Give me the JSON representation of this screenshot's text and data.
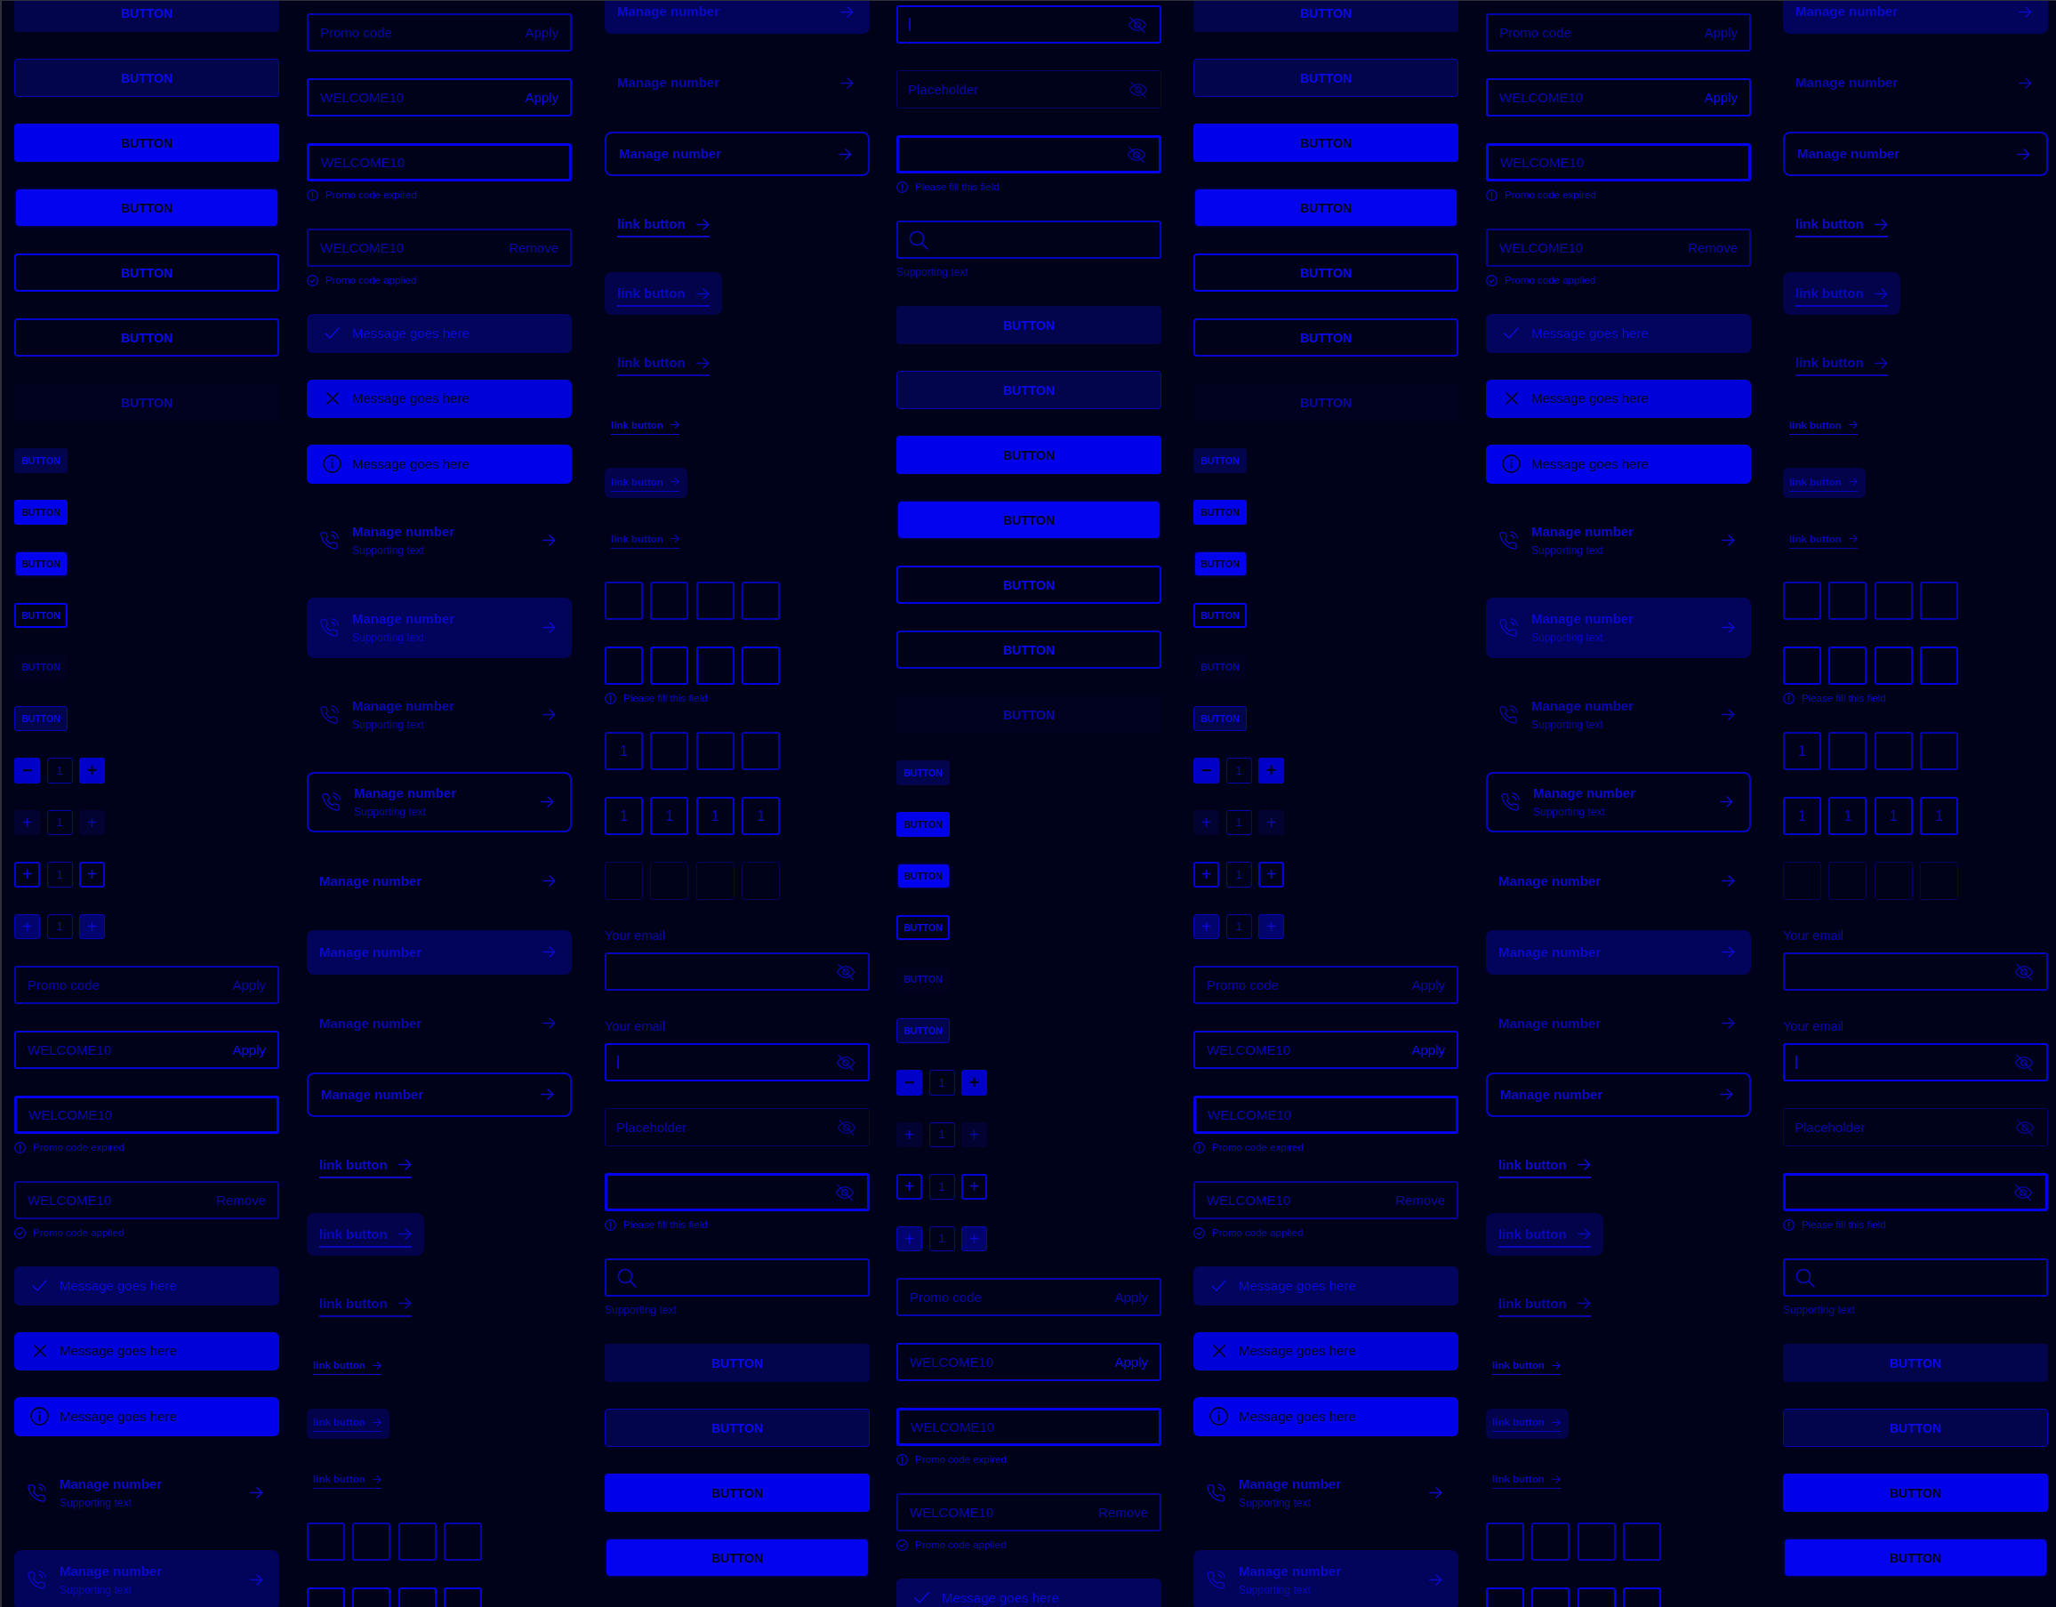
{
  "columns": [
    {
      "items": [
        {
          "kind": "tonal_button",
          "label": "BUTTON",
          "pressed": false,
          "disabled": false
        },
        {
          "kind": "outlined_tonal_button",
          "label": "BUTTON",
          "pressed": false,
          "disabled": false
        },
        {
          "kind": "filled_button",
          "label": "BUTTON",
          "pressed": false,
          "disabled": false
        },
        {
          "kind": "filled_button",
          "label": "BUTTON",
          "pressed": true,
          "disabled": false
        },
        {
          "kind": "outlined_button",
          "label": "BUTTON",
          "pressed": false,
          "disabled": false
        },
        {
          "kind": "soft_outlined_button",
          "label": "BUTTON",
          "pressed": false,
          "disabled": false
        },
        {
          "kind": "tonal_button",
          "label": "BUTTON",
          "pressed": false,
          "disabled": true
        },
        {
          "kind": "small_tonal_button",
          "label": "BUTTON",
          "pressed": false,
          "disabled": false
        },
        {
          "kind": "small_filled_button",
          "label": "BUTTON",
          "pressed": false,
          "disabled": false
        },
        {
          "kind": "small_filled_button",
          "label": "BUTTON",
          "pressed": true,
          "disabled": false
        },
        {
          "kind": "small_outlined_button",
          "label": "BUTTON",
          "pressed": false,
          "disabled": false
        },
        {
          "kind": "small_tonal_button",
          "label": "BUTTON",
          "pressed": false,
          "disabled": true
        },
        {
          "kind": "small_outlined_tonal_button",
          "label": "BUTTON",
          "pressed": false,
          "disabled": false
        },
        {
          "kind": "filled_stepper",
          "left_symbol": "−",
          "value": "1",
          "right_symbol": "+",
          "disabled": false
        },
        {
          "kind": "tonal_stepper",
          "left_symbol": "+",
          "value": "1",
          "right_symbol": "+",
          "disabled": true
        },
        {
          "kind": "outlined_stepper",
          "left_symbol": "+",
          "value": "1",
          "right_symbol": "+",
          "disabled": false
        },
        {
          "kind": "tonal_stepper",
          "left_symbol": "+",
          "value": "1",
          "right_symbol": "+",
          "disabled": false
        },
        {
          "kind": "promo_field",
          "placeholder": "Promo code",
          "action": "Apply",
          "focused": false,
          "error": false,
          "applied": false
        },
        {
          "kind": "promo_field",
          "value": "WELCOME10",
          "action": "Apply",
          "focused": true,
          "error": false,
          "applied": false
        },
        {
          "kind": "promo_field",
          "value": "WELCOME10",
          "helper": "Promo code expired",
          "focused": false,
          "error": true,
          "applied": false
        },
        {
          "kind": "promo_field",
          "value": "WELCOME10",
          "action": "Remove",
          "helper": "Promo code applied",
          "focused": false,
          "error": false,
          "applied": true
        },
        {
          "kind": "success_message",
          "text": "Message goes here"
        },
        {
          "kind": "error_message",
          "text": "Message goes here"
        },
        {
          "kind": "info_message",
          "text": "Message goes here"
        },
        {
          "kind": "contact_item",
          "title": "Manage number",
          "supporting": "Supporting text",
          "disabled": false
        },
        {
          "kind": "tonal_contact_item",
          "title": "Manage number",
          "supporting": "Supporting text",
          "disabled": false
        }
      ]
    },
    {
      "items": [
        {
          "kind": "promo_field",
          "placeholder": "Promo code",
          "action": "Apply",
          "focused": false,
          "error": false,
          "applied": false
        },
        {
          "kind": "promo_field",
          "value": "WELCOME10",
          "action": "Apply",
          "focused": true,
          "error": false,
          "applied": false
        },
        {
          "kind": "promo_field",
          "value": "WELCOME10",
          "helper": "Promo code expired",
          "focused": false,
          "error": true,
          "applied": false
        },
        {
          "kind": "promo_field",
          "value": "WELCOME10",
          "action": "Remove",
          "helper": "Promo code applied",
          "focused": false,
          "error": false,
          "applied": true
        },
        {
          "kind": "success_message",
          "text": "Message goes here"
        },
        {
          "kind": "error_message",
          "text": "Message goes here"
        },
        {
          "kind": "info_message",
          "text": "Message goes here"
        },
        {
          "kind": "contact_item",
          "title": "Manage number",
          "supporting": "Supporting text",
          "disabled": false
        },
        {
          "kind": "tonal_contact_item",
          "title": "Manage number",
          "supporting": "Supporting text",
          "disabled": false
        },
        {
          "kind": "contact_item",
          "title": "Manage number",
          "supporting": "Supporting text",
          "disabled": true
        },
        {
          "kind": "outlined_contact_item",
          "title": "Manage number",
          "supporting": "Supporting text",
          "disabled": false
        },
        {
          "kind": "nav_item",
          "title": "Manage number",
          "disabled": false
        },
        {
          "kind": "tonal_nav_item",
          "title": "Manage number",
          "disabled": false
        },
        {
          "kind": "nav_item",
          "title": "Manage number",
          "disabled": true
        },
        {
          "kind": "outlined_nav_item",
          "title": "Manage number",
          "disabled": false
        },
        {
          "kind": "link",
          "label": "link button",
          "disabled": false
        },
        {
          "kind": "tonal_link",
          "label": "link button",
          "disabled": false
        },
        {
          "kind": "link",
          "label": "link button",
          "disabled": true
        },
        {
          "kind": "small_link",
          "label": "link button",
          "disabled": false
        },
        {
          "kind": "small_tonal_link",
          "label": "link button",
          "disabled": false
        },
        {
          "kind": "small_link",
          "label": "link button",
          "disabled": true
        },
        {
          "kind": "code_input",
          "cells": [
            {},
            {},
            {},
            {}
          ],
          "focused": false,
          "error": false,
          "disabled": false
        },
        {
          "kind": "code_input",
          "cells": [
            {},
            {},
            {},
            {}
          ],
          "focused": false,
          "error": true,
          "disabled": false
        }
      ]
    },
    {
      "items": [
        {
          "kind": "tonal_nav_item",
          "title": "Manage number",
          "disabled": false
        },
        {
          "kind": "nav_item",
          "title": "Manage number",
          "disabled": true
        },
        {
          "kind": "outlined_nav_item",
          "title": "Manage number",
          "disabled": false
        },
        {
          "kind": "link",
          "label": "link button",
          "disabled": false
        },
        {
          "kind": "tonal_link",
          "label": "link button",
          "disabled": false
        },
        {
          "kind": "link",
          "label": "link button",
          "disabled": true
        },
        {
          "kind": "small_link",
          "label": "link button",
          "disabled": false
        },
        {
          "kind": "small_tonal_link",
          "label": "link button",
          "disabled": false
        },
        {
          "kind": "small_link",
          "label": "link button",
          "disabled": true
        },
        {
          "kind": "code_input",
          "cells": [
            {},
            {},
            {},
            {}
          ],
          "focused": false,
          "error": false,
          "disabled": false
        },
        {
          "kind": "code_input",
          "cells": [
            {},
            {},
            {},
            {}
          ],
          "helper": "Please fill this field",
          "focused": false,
          "error": true,
          "disabled": false
        },
        {
          "kind": "code_input",
          "cells": [
            {
              "value": "1"
            },
            {},
            {},
            {}
          ],
          "focused": false,
          "error": false,
          "disabled": false
        },
        {
          "kind": "code_input",
          "cells": [
            {
              "value": "1"
            },
            {
              "value": "1"
            },
            {
              "value": "1"
            },
            {
              "value": "1"
            }
          ],
          "focused": true,
          "error": false,
          "disabled": false
        },
        {
          "kind": "code_input",
          "cells": [
            {},
            {},
            {},
            {}
          ],
          "focused": false,
          "error": false,
          "disabled": true
        },
        {
          "kind": "password_field",
          "label": "Your email",
          "focused": false,
          "error": false,
          "disabled": false
        },
        {
          "kind": "password_field",
          "label": "Your email",
          "focused": true,
          "error": false,
          "disabled": false
        },
        {
          "kind": "password_field",
          "placeholder": "Placeholder",
          "focused": false,
          "error": false,
          "disabled": true
        },
        {
          "kind": "password_field",
          "helper": "Please fill this field",
          "focused": false,
          "error": true,
          "disabled": false
        },
        {
          "kind": "search_field",
          "supporting": "Supporting text"
        },
        {
          "kind": "tonal_button",
          "label": "BUTTON",
          "pressed": false,
          "disabled": false
        },
        {
          "kind": "outlined_tonal_button",
          "label": "BUTTON",
          "pressed": false,
          "disabled": false
        },
        {
          "kind": "filled_button",
          "label": "BUTTON",
          "pressed": false,
          "disabled": false
        },
        {
          "kind": "filled_button",
          "label": "BUTTON",
          "pressed": true,
          "disabled": false
        }
      ]
    },
    {
      "items": [
        {
          "kind": "password_field",
          "focused": true,
          "error": false,
          "disabled": false
        },
        {
          "kind": "password_field",
          "placeholder": "Placeholder",
          "focused": false,
          "error": false,
          "disabled": true
        },
        {
          "kind": "password_field",
          "helper": "Please fill this field",
          "focused": false,
          "error": true,
          "disabled": false
        },
        {
          "kind": "search_field",
          "supporting": "Supporting text"
        },
        {
          "kind": "tonal_button",
          "label": "BUTTON",
          "pressed": false,
          "disabled": false
        },
        {
          "kind": "outlined_tonal_button",
          "label": "BUTTON",
          "pressed": false,
          "disabled": false
        },
        {
          "kind": "filled_button",
          "label": "BUTTON",
          "pressed": false,
          "disabled": false
        },
        {
          "kind": "filled_button",
          "label": "BUTTON",
          "pressed": true,
          "disabled": false
        },
        {
          "kind": "outlined_button",
          "label": "BUTTON",
          "pressed": false,
          "disabled": false
        },
        {
          "kind": "soft_outlined_button",
          "label": "BUTTON",
          "pressed": false,
          "disabled": false
        },
        {
          "kind": "tonal_button",
          "label": "BUTTON",
          "pressed": false,
          "disabled": true
        },
        {
          "kind": "small_tonal_button",
          "label": "BUTTON",
          "pressed": false,
          "disabled": false
        },
        {
          "kind": "small_filled_button",
          "label": "BUTTON",
          "pressed": false,
          "disabled": false
        },
        {
          "kind": "small_filled_button",
          "label": "BUTTON",
          "pressed": true,
          "disabled": false
        },
        {
          "kind": "small_outlined_button",
          "label": "BUTTON",
          "pressed": false,
          "disabled": false
        },
        {
          "kind": "small_tonal_button",
          "label": "BUTTON",
          "pressed": false,
          "disabled": true
        },
        {
          "kind": "small_outlined_tonal_button",
          "label": "BUTTON",
          "pressed": false,
          "disabled": false
        },
        {
          "kind": "filled_stepper",
          "left_symbol": "−",
          "value": "1",
          "right_symbol": "+",
          "disabled": false
        },
        {
          "kind": "tonal_stepper",
          "left_symbol": "+",
          "value": "1",
          "right_symbol": "+",
          "disabled": true
        },
        {
          "kind": "outlined_stepper",
          "left_symbol": "+",
          "value": "1",
          "right_symbol": "+",
          "disabled": false
        },
        {
          "kind": "tonal_stepper",
          "left_symbol": "+",
          "value": "1",
          "right_symbol": "+",
          "disabled": false
        },
        {
          "kind": "promo_field",
          "placeholder": "Promo code",
          "action": "Apply",
          "focused": false,
          "error": false,
          "applied": false
        },
        {
          "kind": "promo_field",
          "value": "WELCOME10",
          "action": "Apply",
          "focused": true,
          "error": false,
          "applied": false
        },
        {
          "kind": "promo_field",
          "value": "WELCOME10",
          "helper": "Promo code expired",
          "focused": false,
          "error": true,
          "applied": false
        },
        {
          "kind": "promo_field",
          "value": "WELCOME10",
          "action": "Remove",
          "helper": "Promo code applied",
          "focused": false,
          "error": false,
          "applied": true
        },
        {
          "kind": "success_message",
          "text": "Message goes here"
        }
      ]
    },
    {
      "items": [
        {
          "kind": "tonal_button",
          "label": "BUTTON",
          "pressed": false,
          "disabled": false
        },
        {
          "kind": "outlined_tonal_button",
          "label": "BUTTON",
          "pressed": false,
          "disabled": false
        },
        {
          "kind": "filled_button",
          "label": "BUTTON",
          "pressed": false,
          "disabled": false
        },
        {
          "kind": "filled_button",
          "label": "BUTTON",
          "pressed": true,
          "disabled": false
        },
        {
          "kind": "outlined_button",
          "label": "BUTTON",
          "pressed": false,
          "disabled": false
        },
        {
          "kind": "soft_outlined_button",
          "label": "BUTTON",
          "pressed": false,
          "disabled": false
        },
        {
          "kind": "tonal_button",
          "label": "BUTTON",
          "pressed": false,
          "disabled": true
        },
        {
          "kind": "small_tonal_button",
          "label": "BUTTON",
          "pressed": false,
          "disabled": false
        },
        {
          "kind": "small_filled_button",
          "label": "BUTTON",
          "pressed": false,
          "disabled": false
        },
        {
          "kind": "small_filled_button",
          "label": "BUTTON",
          "pressed": true,
          "disabled": false
        },
        {
          "kind": "small_outlined_button",
          "label": "BUTTON",
          "pressed": false,
          "disabled": false
        },
        {
          "kind": "small_tonal_button",
          "label": "BUTTON",
          "pressed": false,
          "disabled": true
        },
        {
          "kind": "small_outlined_tonal_button",
          "label": "BUTTON",
          "pressed": false,
          "disabled": false
        },
        {
          "kind": "filled_stepper",
          "left_symbol": "−",
          "value": "1",
          "right_symbol": "+",
          "disabled": false
        },
        {
          "kind": "tonal_stepper",
          "left_symbol": "+",
          "value": "1",
          "right_symbol": "+",
          "disabled": true
        },
        {
          "kind": "outlined_stepper",
          "left_symbol": "+",
          "value": "1",
          "right_symbol": "+",
          "disabled": false
        },
        {
          "kind": "tonal_stepper",
          "left_symbol": "+",
          "value": "1",
          "right_symbol": "+",
          "disabled": false
        },
        {
          "kind": "promo_field",
          "placeholder": "Promo code",
          "action": "Apply",
          "focused": false,
          "error": false,
          "applied": false
        },
        {
          "kind": "promo_field",
          "value": "WELCOME10",
          "action": "Apply",
          "focused": true,
          "error": false,
          "applied": false
        },
        {
          "kind": "promo_field",
          "value": "WELCOME10",
          "helper": "Promo code expired",
          "focused": false,
          "error": true,
          "applied": false
        },
        {
          "kind": "promo_field",
          "value": "WELCOME10",
          "action": "Remove",
          "helper": "Promo code applied",
          "focused": false,
          "error": false,
          "applied": true
        },
        {
          "kind": "success_message",
          "text": "Message goes here"
        },
        {
          "kind": "error_message",
          "text": "Message goes here"
        },
        {
          "kind": "info_message",
          "text": "Message goes here"
        },
        {
          "kind": "contact_item",
          "title": "Manage number",
          "supporting": "Supporting text",
          "disabled": false
        },
        {
          "kind": "tonal_contact_item",
          "title": "Manage number",
          "supporting": "Supporting text",
          "disabled": false
        }
      ]
    },
    {
      "items": [
        {
          "kind": "promo_field",
          "placeholder": "Promo code",
          "action": "Apply",
          "focused": false,
          "error": false,
          "applied": false
        },
        {
          "kind": "promo_field",
          "value": "WELCOME10",
          "action": "Apply",
          "focused": true,
          "error": false,
          "applied": false
        },
        {
          "kind": "promo_field",
          "value": "WELCOME10",
          "helper": "Promo code expired",
          "focused": false,
          "error": true,
          "applied": false
        },
        {
          "kind": "promo_field",
          "value": "WELCOME10",
          "action": "Remove",
          "helper": "Promo code applied",
          "focused": false,
          "error": false,
          "applied": true
        },
        {
          "kind": "success_message",
          "text": "Message goes here"
        },
        {
          "kind": "error_message",
          "text": "Message goes here"
        },
        {
          "kind": "info_message",
          "text": "Message goes here"
        },
        {
          "kind": "contact_item",
          "title": "Manage number",
          "supporting": "Supporting text",
          "disabled": false
        },
        {
          "kind": "tonal_contact_item",
          "title": "Manage number",
          "supporting": "Supporting text",
          "disabled": false
        },
        {
          "kind": "contact_item",
          "title": "Manage number",
          "supporting": "Supporting text",
          "disabled": true
        },
        {
          "kind": "outlined_contact_item",
          "title": "Manage number",
          "supporting": "Supporting text",
          "disabled": false
        },
        {
          "kind": "nav_item",
          "title": "Manage number",
          "disabled": false
        },
        {
          "kind": "tonal_nav_item",
          "title": "Manage number",
          "disabled": false
        },
        {
          "kind": "nav_item",
          "title": "Manage number",
          "disabled": true
        },
        {
          "kind": "outlined_nav_item",
          "title": "Manage number",
          "disabled": false
        },
        {
          "kind": "link",
          "label": "link button",
          "disabled": false
        },
        {
          "kind": "tonal_link",
          "label": "link button",
          "disabled": false
        },
        {
          "kind": "link",
          "label": "link button",
          "disabled": true
        },
        {
          "kind": "small_link",
          "label": "link button",
          "disabled": false
        },
        {
          "kind": "small_tonal_link",
          "label": "link button",
          "disabled": false
        },
        {
          "kind": "small_link",
          "label": "link button",
          "disabled": true
        },
        {
          "kind": "code_input",
          "cells": [
            {},
            {},
            {},
            {}
          ],
          "focused": false,
          "error": false,
          "disabled": false
        },
        {
          "kind": "code_input",
          "cells": [
            {},
            {},
            {},
            {}
          ],
          "focused": false,
          "error": true,
          "disabled": false
        }
      ]
    },
    {
      "items": [
        {
          "kind": "tonal_nav_item",
          "title": "Manage number",
          "disabled": false
        },
        {
          "kind": "nav_item",
          "title": "Manage number",
          "disabled": true
        },
        {
          "kind": "outlined_nav_item",
          "title": "Manage number",
          "disabled": false
        },
        {
          "kind": "link",
          "label": "link button",
          "disabled": false
        },
        {
          "kind": "tonal_link",
          "label": "link button",
          "disabled": false
        },
        {
          "kind": "link",
          "label": "link button",
          "disabled": true
        },
        {
          "kind": "small_link",
          "label": "link button",
          "disabled": false
        },
        {
          "kind": "small_tonal_link",
          "label": "link button",
          "disabled": false
        },
        {
          "kind": "small_link",
          "label": "link button",
          "disabled": true
        },
        {
          "kind": "code_input",
          "cells": [
            {},
            {},
            {},
            {}
          ],
          "focused": false,
          "error": false,
          "disabled": false
        },
        {
          "kind": "code_input",
          "cells": [
            {},
            {},
            {},
            {}
          ],
          "helper": "Please fill this field",
          "focused": false,
          "error": true,
          "disabled": false
        },
        {
          "kind": "code_input",
          "cells": [
            {
              "value": "1"
            },
            {},
            {},
            {}
          ],
          "focused": false,
          "error": false,
          "disabled": false
        },
        {
          "kind": "code_input",
          "cells": [
            {
              "value": "1"
            },
            {
              "value": "1"
            },
            {
              "value": "1"
            },
            {
              "value": "1"
            }
          ],
          "focused": true,
          "error": false,
          "disabled": false
        },
        {
          "kind": "code_input",
          "cells": [
            {},
            {},
            {},
            {}
          ],
          "focused": false,
          "error": false,
          "disabled": true
        },
        {
          "kind": "password_field",
          "label": "Your email",
          "focused": false,
          "error": false,
          "disabled": false
        },
        {
          "kind": "password_field",
          "label": "Your email",
          "focused": true,
          "error": false,
          "disabled": false
        },
        {
          "kind": "password_field",
          "placeholder": "Placeholder",
          "focused": false,
          "error": false,
          "disabled": true
        },
        {
          "kind": "password_field",
          "helper": "Please fill this field",
          "focused": false,
          "error": true,
          "disabled": false
        },
        {
          "kind": "search_field",
          "supporting": "Supporting text"
        },
        {
          "kind": "tonal_button",
          "label": "BUTTON",
          "pressed": false,
          "disabled": false
        },
        {
          "kind": "outlined_tonal_button",
          "label": "BUTTON",
          "pressed": false,
          "disabled": false
        },
        {
          "kind": "filled_button",
          "label": "BUTTON",
          "pressed": false,
          "disabled": false
        },
        {
          "kind": "filled_button",
          "label": "BUTTON",
          "pressed": true,
          "disabled": false
        }
      ]
    }
  ]
}
